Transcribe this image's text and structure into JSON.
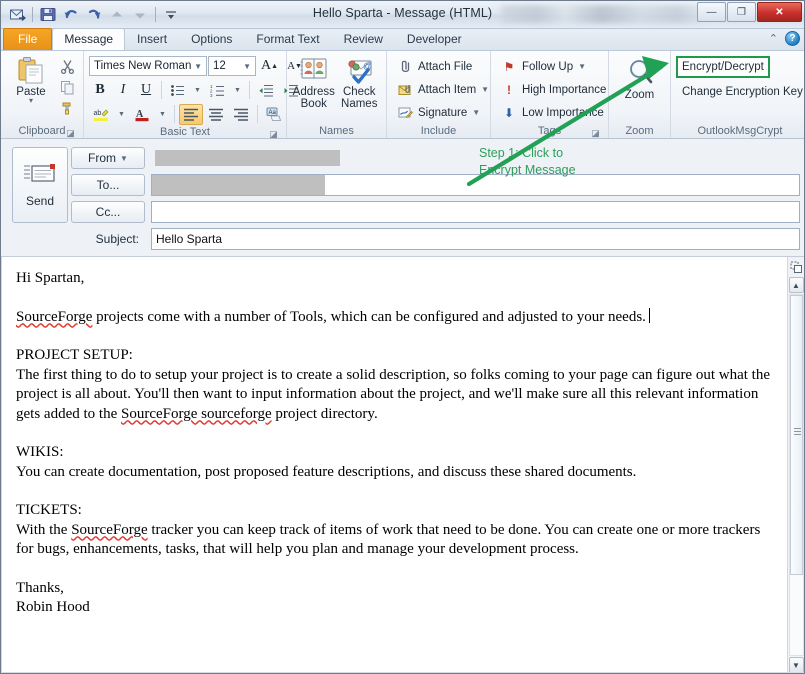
{
  "window": {
    "title": "Hello Sparta  -  Message (HTML)",
    "blurred_region_present": true,
    "minimize_label": "—",
    "maximize_label": "❐",
    "close_label": "✕"
  },
  "quick_access": {
    "items": [
      {
        "name": "send-receive-icon",
        "glyph": "✉"
      },
      {
        "name": "save-icon",
        "glyph": "💾"
      },
      {
        "name": "undo-icon",
        "glyph": "↶"
      },
      {
        "name": "redo-icon",
        "glyph": "↷"
      },
      {
        "name": "previous-item-icon",
        "glyph": "◆"
      },
      {
        "name": "next-item-icon",
        "glyph": "◆"
      },
      {
        "name": "customize-qat-icon",
        "glyph": "▾"
      }
    ]
  },
  "ribbon": {
    "tabs": [
      {
        "label": "File",
        "type": "file"
      },
      {
        "label": "Message",
        "type": "active"
      },
      {
        "label": "Insert",
        "type": "normal"
      },
      {
        "label": "Options",
        "type": "normal"
      },
      {
        "label": "Format Text",
        "type": "normal"
      },
      {
        "label": "Review",
        "type": "normal"
      },
      {
        "label": "Developer",
        "type": "normal"
      }
    ],
    "corner": {
      "minimize_ribbon": "⌃",
      "help": "?"
    },
    "groups": {
      "clipboard": {
        "label": "Clipboard",
        "paste_label": "Paste",
        "paste_dropdown": "▾",
        "cut_glyph": "✂",
        "copy_glyph": "⧉",
        "format_painter_glyph": "🖌",
        "launcher": "◪"
      },
      "basic_text": {
        "label": "Basic Text",
        "font_name": "Times New Roman",
        "font_size": "12",
        "grow_font": "A",
        "shrink_font": "A",
        "bold": "B",
        "italic": "I",
        "underline": "U",
        "bullets": "☰",
        "numbering": "≔",
        "decrease_indent": "⇤",
        "increase_indent": "⇥",
        "highlight": "ab",
        "font_color": "A",
        "align_left": "≡",
        "align_center": "≡",
        "align_right": "≡",
        "clear_formatting": "A",
        "launcher": "◪"
      },
      "names": {
        "label": "Names",
        "address_book": "Address\nBook",
        "address_book_line1": "Address",
        "address_book_line2": "Book",
        "check_names_line1": "Check",
        "check_names_line2": "Names"
      },
      "include": {
        "label": "Include",
        "items": [
          {
            "label": "Attach File",
            "icon": "paperclip-icon",
            "glyph": "📎",
            "dropdown": false
          },
          {
            "label": "Attach Item",
            "icon": "attach-item-icon",
            "glyph": "✉",
            "dropdown": true
          },
          {
            "label": "Signature",
            "icon": "signature-icon",
            "glyph": "✎",
            "dropdown": true
          }
        ]
      },
      "tags": {
        "label": "Tags",
        "items": [
          {
            "label": "Follow Up",
            "icon": "flag-icon",
            "glyph": "⚑",
            "dropdown": true,
            "color": "#c0392b"
          },
          {
            "label": "High Importance",
            "icon": "exclamation-icon",
            "glyph": "❗",
            "dropdown": false,
            "color": "#c0392b"
          },
          {
            "label": "Low Importance",
            "icon": "down-arrow-icon",
            "glyph": "⬇",
            "dropdown": false,
            "color": "#2b5faa"
          }
        ],
        "launcher": "◪"
      },
      "zoom": {
        "group_label": "Zoom",
        "button_label": "Zoom",
        "icon": "magnifier-icon"
      },
      "outlook_msg_crypt": {
        "label": "OutlookMsgCrypt",
        "items": [
          {
            "label": "Encrypt/Decrypt",
            "highlighted": true
          },
          {
            "label": "Change Encryption Key",
            "highlighted": false
          }
        ]
      }
    }
  },
  "annotation": {
    "line1": "Step 1: Click to",
    "line2": "Encrypt Message",
    "color": "#2e9e5b",
    "highlight_color": "#1f9a4d"
  },
  "compose": {
    "send_label": "Send",
    "send_icon": "send-envelope-icon",
    "from": {
      "label": "From",
      "dropdown": "▾",
      "value": "",
      "redacted": true
    },
    "to": {
      "label": "To...",
      "value": "",
      "redacted": true
    },
    "cc": {
      "label": "Cc...",
      "value": "",
      "redacted": false
    },
    "subject": {
      "label": "Subject:",
      "value": "Hello Sparta"
    }
  },
  "body": {
    "greeting": "Hi Spartan,",
    "intro": {
      "misspelled": "SourceForge",
      "rest": " projects come with a number of Tools, which can be configured and adjusted to your needs."
    },
    "sections": [
      {
        "heading": "PROJECT SETUP:",
        "text_before": "The first thing to do to setup your project is to create a solid description, so folks coming to your page can figure out what the project is all about. You'll then want to input information about the project, and we'll make sure all this relevant information gets added to the ",
        "misspelled": "SourceForge sourceforge",
        "text_after": " project directory."
      },
      {
        "heading": "WIKIS:",
        "text_before": "You can create documentation, post proposed feature descriptions, and discuss these shared documents.",
        "misspelled": "",
        "text_after": ""
      },
      {
        "heading": "TICKETS:",
        "text_before": "With the ",
        "misspelled": "SourceForge",
        "text_after": " tracker you can keep track of items of work that need to be done. You can create one or more trackers for bugs, enhancements, tasks, that will help you plan and manage your development process."
      }
    ],
    "closing_line1": "Thanks,",
    "closing_line2": "Robin Hood"
  },
  "scrollbar": {
    "select_browse_object": "⬚",
    "up_arrow": "▲",
    "down_arrow": "▼"
  }
}
